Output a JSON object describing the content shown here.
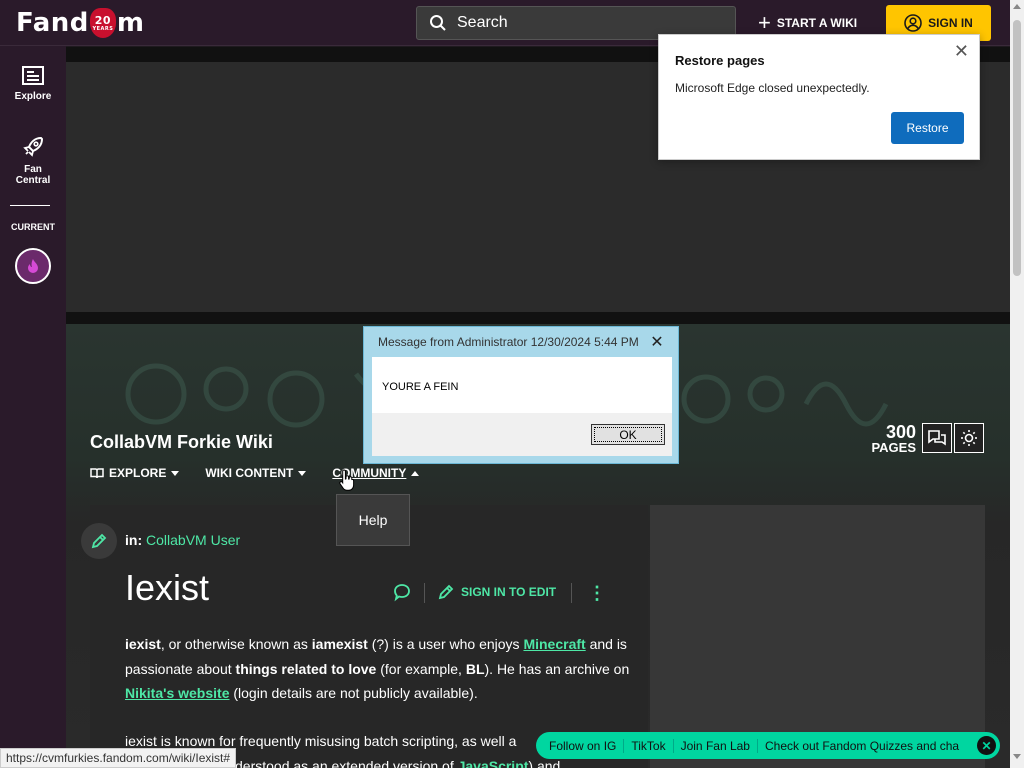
{
  "header": {
    "logo_text_prefix": "Fand",
    "logo_badge": "20",
    "logo_badge_sub": "YEARS",
    "logo_text_suffix": "m",
    "search_placeholder": "Search",
    "start_wiki": "START A WIKI",
    "sign_in": "SIGN IN"
  },
  "rail": {
    "explore": "Explore",
    "fan_central": "Fan Central",
    "current": "CURRENT"
  },
  "restore_popup": {
    "title": "Restore pages",
    "message": "Microsoft Edge closed unexpectedly.",
    "button": "Restore"
  },
  "dialog": {
    "title": "Message from Administrator 12/30/2024 5:44 PM",
    "message": "YOURE A FEIN",
    "ok": "OK"
  },
  "wiki": {
    "name": "CollabVM Forkie Wiki",
    "nav": [
      "EXPLORE",
      "WIKI CONTENT",
      "COMMUNITY"
    ],
    "pages_count": "300",
    "pages_label": "PAGES",
    "help_item": "Help"
  },
  "article": {
    "in_label": "in:",
    "category": "CollabVM User",
    "title": "Iexist",
    "sign_in_to_edit": "SIGN IN TO EDIT",
    "p1": {
      "t1": "iexist",
      "t2": ", or otherwise known as ",
      "t3": "iamexist",
      "t4": " (?) is a user who enjoys ",
      "link1": "Minecraft",
      "t5": " and is passionate about ",
      "t6": "things related to love",
      "t7": " (for example, ",
      "t8": "BL",
      "t9": "). He has an archive on ",
      "link2": "Nikita's website",
      "t10": " (login details are not publicly available)."
    },
    "p2": {
      "t1": "iexist is known for frequently misusing batch scripting, as well a",
      "t2": "derstood as an extended version of ",
      "link": "JavaScript",
      "t3": ") and"
    }
  },
  "status_url": "https://cvmfurkies.fandom.com/wiki/Iexist#",
  "social_bar": {
    "items": [
      "Follow on IG",
      "TikTok",
      "Join Fan Lab",
      "Check out Fandom Quizzes and cha"
    ]
  },
  "colors": {
    "accent_green": "#4ee7a6",
    "signin_yellow": "#ffc500",
    "edge_blue": "#0f6cbd",
    "social_green": "#00d6a0"
  }
}
